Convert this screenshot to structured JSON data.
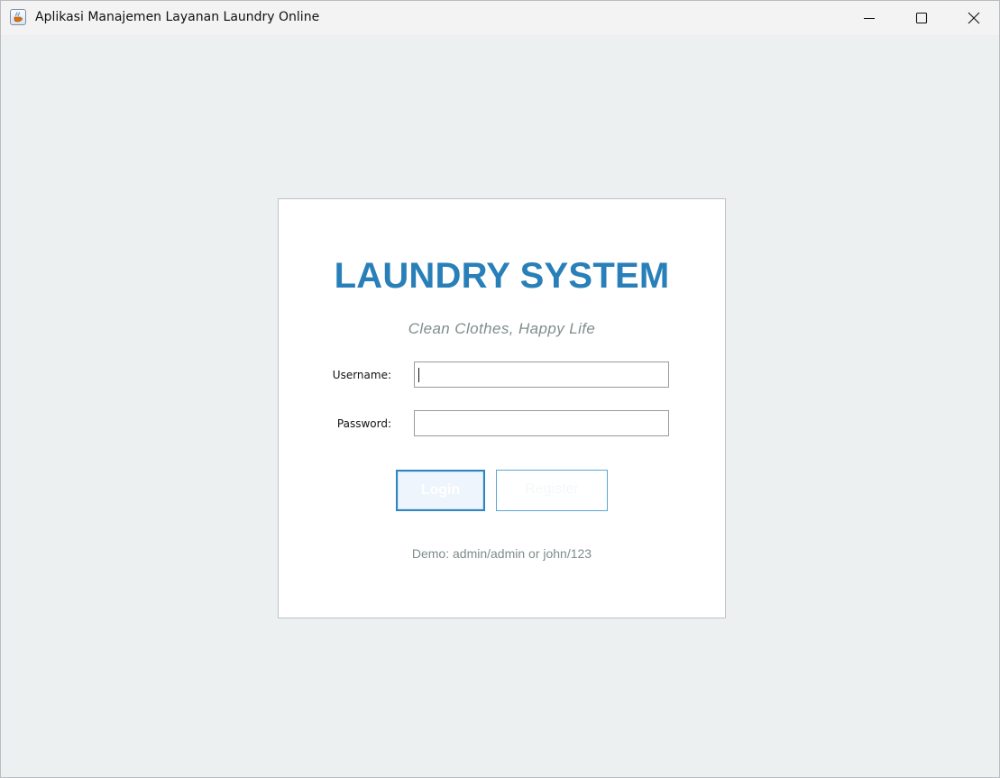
{
  "window": {
    "title": "Aplikasi Manajemen Layanan Laundry Online",
    "icon": "java-cup-icon",
    "controls": [
      "minimize-icon",
      "maximize-icon",
      "close-icon"
    ]
  },
  "login": {
    "title": "LAUNDRY SYSTEM",
    "tagline": "Clean Clothes, Happy Life",
    "username_label": "Username:",
    "username_value": "",
    "password_label": "Password:",
    "password_value": "",
    "login_button": "Login",
    "register_button": "Register",
    "demo_hint": "Demo: admin/admin or john/123"
  },
  "colors": {
    "accent": "#2980b9",
    "background": "#ecf0f1",
    "muted_text": "#7f8c8d",
    "card": "#ffffff"
  }
}
